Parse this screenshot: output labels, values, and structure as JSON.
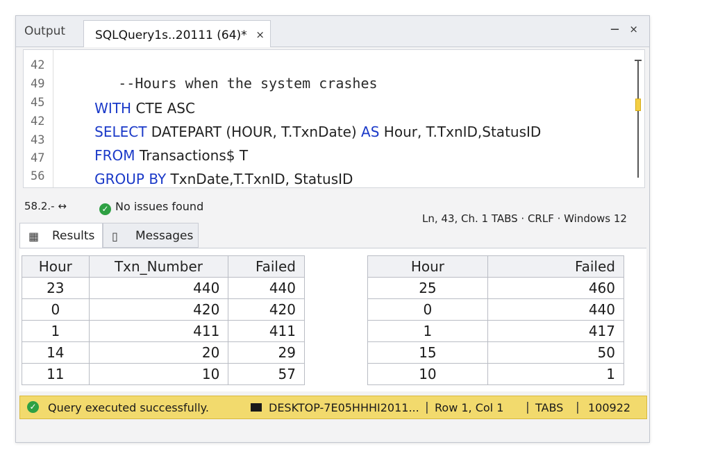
{
  "tabs": {
    "output_label": "Output",
    "active_label": "SQLQuery1s..20111 (64)*",
    "close_glyph": "×",
    "minimize_glyph": "−",
    "pin_glyph": "⨯"
  },
  "editor": {
    "line_numbers": [
      "42",
      "49",
      "45",
      "42",
      "43",
      "47",
      "56"
    ],
    "lines": [
      {
        "comment": "--Hours when the system crashes"
      },
      {
        "kw1": "WITH",
        "rest1": " CTE ASC"
      },
      {
        "kw1": "SELECT",
        "rest1": " DATEPART (HOUR, T.TxnDate) ",
        "kw2": "AS",
        "rest2": " Hour, T.TxnID,StatusID"
      },
      {
        "kw1": "FROM",
        "rest1": " Transactions$ T"
      },
      {
        "kw1": "GROUP BY",
        "rest1": " TxnDate,T.TxnID, StatusID"
      }
    ]
  },
  "status_row": {
    "zoom": "58.2.- ↔",
    "issues": "No issues found",
    "cursor_info": "Ln, 43, Ch. 1   TABS · CRLF · Windows  12"
  },
  "results_tabs": {
    "results_label": "Results",
    "messages_label": "Messages"
  },
  "grid1": {
    "headers": [
      "Hour",
      "Txn_Number",
      "Failed"
    ],
    "rows": [
      [
        "23",
        "440",
        "440"
      ],
      [
        "0",
        "420",
        "420"
      ],
      [
        "1",
        "411",
        "411"
      ],
      [
        "14",
        "20",
        "29"
      ],
      [
        "11",
        "10",
        "57"
      ]
    ]
  },
  "grid2": {
    "headers": [
      "Hour",
      "Failed"
    ],
    "rows": [
      [
        "25",
        "460"
      ],
      [
        "0",
        "440"
      ],
      [
        "1",
        "417"
      ],
      [
        "15",
        "50"
      ],
      [
        "10",
        "1"
      ]
    ]
  },
  "statusbar": {
    "message": "Query executed successfully.",
    "server": "DESKTOP-7E05HHHI2011...",
    "position": "Row 1, Col 1",
    "tabs": "TABS",
    "rows": "100922",
    "separator": "|",
    "color": "#f2da6d"
  }
}
